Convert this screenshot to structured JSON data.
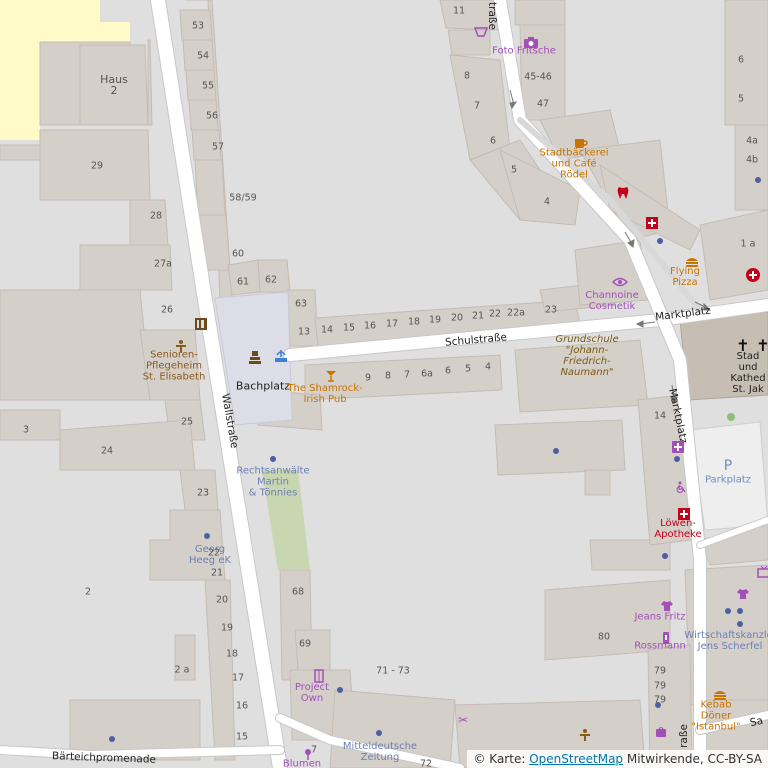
{
  "attribution": {
    "prefix": "© Karte: ",
    "link": "OpenStreetMap",
    "suffix": " Mitwirkende, CC-BY-SA"
  },
  "streets": {
    "wallstrasse": "Wallstraße",
    "schulstrasse": "Schulstraße",
    "marktplatz_top": "Marktplatz",
    "marktplatz_side": "Marktplatz",
    "strasse_top": "traße",
    "strasse_bottom": "raße",
    "baerteichpromenade": "Bärteichpromenade",
    "sa": "Sa"
  },
  "places": {
    "bachplatz": "Bachplatz",
    "haus2": "Haus\n2",
    "foto_fritsche": "Foto Fritsche",
    "stadtbaeckerei": "Stadtbäckerei\nund Café\nRödel",
    "flying_pizza": "Flying\nPizza",
    "channoine": "Channoine\nCosmetik",
    "grundschule": "Grundschule\n\"Johann-\nFriedrich-\nNaumann\"",
    "shamrock": "The Shamrock-\nIrish Pub",
    "seniorenheim": "Senioren-\nPflegeheim\nSt. Elisabeth",
    "rechtsanwaelte": "Rechtsanwälte\nMartin\n& Tönnies",
    "georg_heeg": "Georg\nHeeg eK",
    "loewen_apotheke": "Löwen-\nApotheke",
    "parkplatz": "Parkplatz",
    "jeans_fritz": "Jeans Fritz",
    "rossmann": "Rossmann",
    "wirtschaftskanzlei": "Wirtschaftskanzlei\nJens Scherfel",
    "kebab": "Kebab\nDöner\n\"Istanbul\"",
    "project_own": "Project\nOwn",
    "mitteldeutsche": "Mitteldeutsche\nZeitung",
    "blumen": "Blumen",
    "kathedrale": "Stad\nund Kathed\nSt. Jak"
  },
  "numbers": [
    "11",
    "53",
    "54",
    "55",
    "56",
    "57",
    "58/59",
    "60",
    "61",
    "62",
    "63",
    "13",
    "14",
    "15",
    "16",
    "17",
    "18",
    "19",
    "20",
    "21",
    "22",
    "22a",
    "23",
    "9",
    "8",
    "7",
    "6a",
    "6",
    "5",
    "4",
    "29",
    "28",
    "27a",
    "26",
    "25",
    "24",
    "23",
    "22",
    "21",
    "20",
    "19",
    "18",
    "17",
    "16",
    "15",
    "3",
    "2",
    "2 a",
    "8",
    "7",
    "6",
    "5",
    "4",
    "45-46",
    "47",
    "6",
    "5",
    "4a",
    "4b",
    "1 a",
    "14",
    "80",
    "79",
    "79",
    "79",
    "68",
    "69",
    "71 - 73",
    "72",
    "7"
  ],
  "icons": {
    "camera": "camera-icon",
    "cafe": "cafe-icon",
    "dentist": "dentist-icon",
    "pharmacy": "pharmacy-icon",
    "burger": "burger-icon",
    "cosmetics": "cosmetics-icon",
    "bar": "bar-icon",
    "fountain": "fountain-icon",
    "monument": "monument-icon",
    "nursing_home": "nursing-home-icon",
    "book": "bookshelf-icon",
    "church": "church-icon",
    "parking": "parking-icon",
    "clothes": "clothes-icon",
    "wheelchair": "wheelchair-icon",
    "tv": "tv-icon"
  },
  "colors": {
    "road": "#ffffff",
    "building": "#d5cfc9",
    "land": "#e0dfdf",
    "school_yard": "#fffac8",
    "plaza": "#dddde8",
    "green": "#c8d7b0",
    "church": "#c6bdb3",
    "parking": "#eeeeee"
  }
}
